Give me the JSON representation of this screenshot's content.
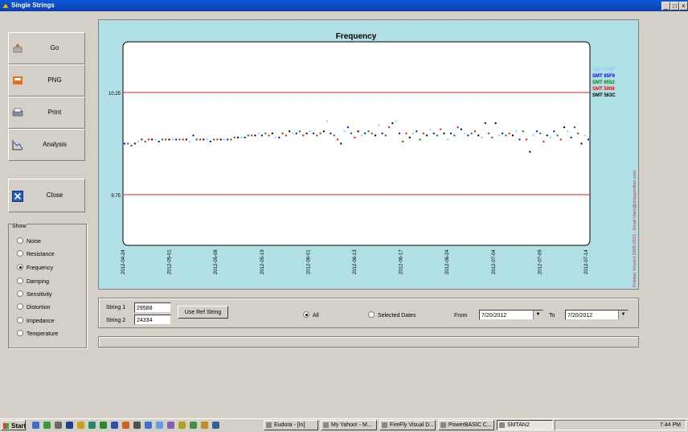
{
  "window": {
    "title": "Single Strings"
  },
  "sidebar": {
    "buttons": [
      {
        "label": "Go"
      },
      {
        "label": "PNG"
      },
      {
        "label": "Print"
      },
      {
        "label": "Analysis"
      }
    ],
    "close_label": "Close",
    "show": {
      "title": "Show",
      "options": [
        "Noise",
        "Resistance",
        "Frequency",
        "Damping",
        "Sensitivity",
        "Distortion",
        "Impedance",
        "Temperature"
      ],
      "selected": "Frequency"
    }
  },
  "chart_data": {
    "type": "scatter",
    "title": "Frequency",
    "y_ticks": [
      "10.25",
      "9.75"
    ],
    "reference_lines": [
      10.25,
      9.75
    ],
    "ylim": [
      9.5,
      10.5
    ],
    "x_tick_labels": [
      "2012-04-24",
      "2012-05-01",
      "2012-05-08",
      "2012-05-19",
      "2012-06-01",
      "2012-06-13",
      "2012-06-17",
      "2012-06-24",
      "2012-07-04",
      "2012-07-09",
      "2012-07-14"
    ],
    "legend": [
      {
        "name": "SMT 576F",
        "color": "#87ceeb"
      },
      {
        "name": "SMT 65F9",
        "color": "#0000ff"
      },
      {
        "name": "SMT 6552",
        "color": "#008000"
      },
      {
        "name": "SMT 5908",
        "color": "#ff0000"
      },
      {
        "name": "SMT 563C",
        "color": "#000000"
      }
    ],
    "legend_position": "right",
    "watermark": "Kristian Vinzent 2009-2012 - Email Ham@strapprofiles.com",
    "grid": false,
    "series_colors": [
      "#0000ff",
      "#008000",
      "#ff0000",
      "#000000",
      "#87ceeb"
    ],
    "points": [
      [
        0,
        10.0
      ],
      [
        1,
        10.0
      ],
      [
        2,
        9.99
      ],
      [
        3,
        10.0
      ],
      [
        4,
        10.01
      ],
      [
        5,
        10.02
      ],
      [
        6,
        10.01
      ],
      [
        7,
        10.02
      ],
      [
        8,
        10.02
      ],
      [
        9,
        10.02
      ],
      [
        10,
        10.01
      ],
      [
        11,
        10.02
      ],
      [
        12,
        10.02
      ],
      [
        13,
        10.02
      ],
      [
        14,
        10.02
      ],
      [
        15,
        10.02
      ],
      [
        16,
        10.02
      ],
      [
        17,
        10.02
      ],
      [
        18,
        10.02
      ],
      [
        19,
        10.01
      ],
      [
        20,
        10.04
      ],
      [
        21,
        10.02
      ],
      [
        22,
        10.02
      ],
      [
        23,
        10.02
      ],
      [
        24,
        10.02
      ],
      [
        25,
        10.01
      ],
      [
        26,
        10.02
      ],
      [
        27,
        10.02
      ],
      [
        28,
        10.02
      ],
      [
        29,
        10.02
      ],
      [
        30,
        10.02
      ],
      [
        31,
        10.02
      ],
      [
        32,
        10.03
      ],
      [
        33,
        10.03
      ],
      [
        34,
        10.03
      ],
      [
        35,
        10.03
      ],
      [
        36,
        10.04
      ],
      [
        37,
        10.04
      ],
      [
        38,
        10.04
      ],
      [
        39,
        10.05
      ],
      [
        40,
        10.04
      ],
      [
        41,
        10.05
      ],
      [
        42,
        10.04
      ],
      [
        43,
        10.05
      ],
      [
        44,
        10.03
      ],
      [
        45,
        10.03
      ],
      [
        46,
        10.05
      ],
      [
        47,
        10.04
      ],
      [
        48,
        10.06
      ],
      [
        49,
        10.05
      ],
      [
        50,
        10.05
      ],
      [
        51,
        10.06
      ],
      [
        52,
        10.04
      ],
      [
        53,
        10.05
      ],
      [
        54,
        10.06
      ],
      [
        55,
        10.05
      ],
      [
        56,
        10.04
      ],
      [
        57,
        10.05
      ],
      [
        58,
        10.06
      ],
      [
        59,
        10.11
      ],
      [
        60,
        10.05
      ],
      [
        61,
        10.04
      ],
      [
        62,
        10.02
      ],
      [
        63,
        10.0
      ],
      [
        64,
        10.06
      ],
      [
        65,
        10.08
      ],
      [
        66,
        10.05
      ],
      [
        67,
        10.03
      ],
      [
        68,
        10.06
      ],
      [
        69,
        10.04
      ],
      [
        70,
        10.05
      ],
      [
        71,
        10.06
      ],
      [
        72,
        10.05
      ],
      [
        73,
        10.04
      ],
      [
        74,
        10.09
      ],
      [
        75,
        10.05
      ],
      [
        76,
        10.04
      ],
      [
        77,
        10.08
      ],
      [
        78,
        10.1
      ],
      [
        79,
        10.11
      ],
      [
        80,
        10.05
      ],
      [
        81,
        10.01
      ],
      [
        82,
        10.05
      ],
      [
        83,
        10.03
      ],
      [
        84,
        10.05
      ],
      [
        85,
        10.06
      ],
      [
        86,
        10.02
      ],
      [
        87,
        10.05
      ],
      [
        88,
        10.04
      ],
      [
        89,
        10.07
      ],
      [
        90,
        10.05
      ],
      [
        91,
        10.04
      ],
      [
        92,
        10.07
      ],
      [
        93,
        10.05
      ],
      [
        94,
        10.02
      ],
      [
        95,
        10.05
      ],
      [
        96,
        10.04
      ],
      [
        97,
        10.08
      ],
      [
        98,
        10.07
      ],
      [
        99,
        10.05
      ],
      [
        100,
        10.04
      ],
      [
        101,
        10.05
      ],
      [
        102,
        10.06
      ],
      [
        103,
        10.04
      ],
      [
        104,
        10.03
      ],
      [
        105,
        10.1
      ],
      [
        106,
        10.05
      ],
      [
        107,
        10.03
      ],
      [
        108,
        10.1
      ],
      [
        109,
        10.04
      ],
      [
        110,
        10.05
      ],
      [
        111,
        10.04
      ],
      [
        112,
        10.05
      ],
      [
        113,
        10.04
      ],
      [
        114,
        10.06
      ],
      [
        115,
        10.02
      ],
      [
        116,
        10.06
      ],
      [
        117,
        10.02
      ],
      [
        118,
        9.96
      ],
      [
        119,
        10.04
      ],
      [
        120,
        10.06
      ],
      [
        121,
        10.05
      ],
      [
        122,
        10.01
      ],
      [
        123,
        10.04
      ],
      [
        124,
        10.03
      ],
      [
        125,
        10.06
      ],
      [
        126,
        10.04
      ],
      [
        127,
        10.02
      ],
      [
        128,
        10.08
      ],
      [
        129,
        10.06
      ],
      [
        130,
        10.03
      ],
      [
        131,
        10.08
      ],
      [
        132,
        10.05
      ],
      [
        133,
        10.0
      ],
      [
        134,
        10.04
      ],
      [
        135,
        10.02
      ]
    ]
  },
  "controls": {
    "string1_label": "String 1",
    "string1_value": "29588",
    "string2_label": "String 2",
    "string2_value": "24334",
    "use_ref_label": "Use Ref String",
    "all_label": "All",
    "selected_dates_label": "Selected Dates",
    "from_label": "From",
    "from_value": "7/20/2012",
    "to_label": "To",
    "to_value": "7/20/2012"
  },
  "taskbar": {
    "start_label": "Start",
    "tasks": [
      "Eudora - [In]",
      "My Yahoo! - M...",
      "FireFly Visual D...",
      "PowerBASIC C...",
      "SMTAN2"
    ],
    "clock": "7:44 PM"
  }
}
